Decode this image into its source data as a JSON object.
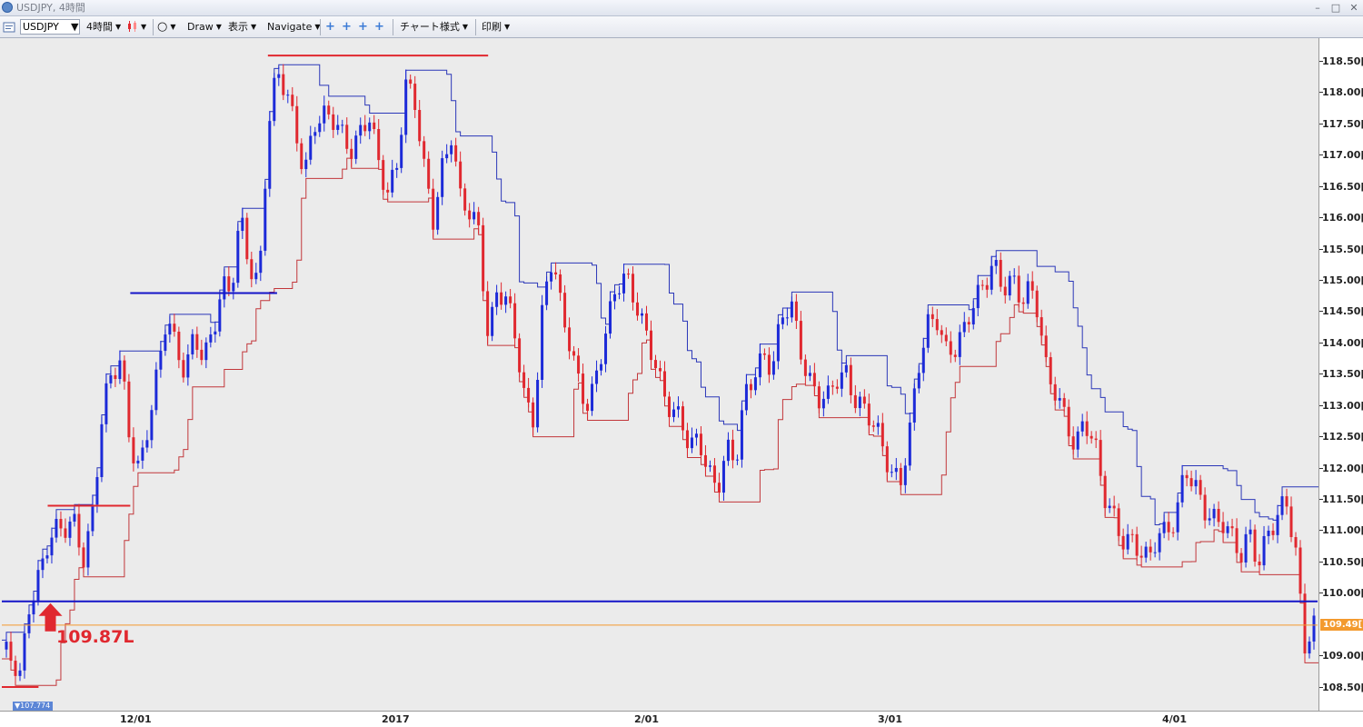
{
  "window": {
    "title": "USDJPY, 4時間",
    "min_glyph": "–",
    "max_glyph": "□",
    "close_glyph": "✕"
  },
  "toolbar": {
    "symbol": "USDJPY",
    "timeframe": "4時間",
    "draw": "Draw",
    "view": "表示",
    "navigate": "Navigate",
    "chart_style": "チャート様式",
    "print": "印刷",
    "dropdown_glyph": "▼",
    "circle_glyph": "○",
    "crosshair_glyph": "+"
  },
  "price_axis": [
    "118.50[0",
    "118.00[0",
    "117.50[0",
    "117.00[0",
    "116.50[0",
    "116.00[0",
    "115.50[0",
    "115.00[0",
    "114.50[0",
    "114.00[0",
    "113.50[0",
    "113.00[0",
    "112.50[0",
    "112.00[0",
    "111.50[0",
    "111.00[0",
    "110.50[0",
    "110.00[0",
    "109.00[0",
    "108.50[0"
  ],
  "time_axis": [
    "12/01",
    "2017",
    "2/01",
    "3/01",
    "4/01"
  ],
  "current_price_label": "109.49[",
  "low_marker_label": "▼107.774",
  "annotation": "109.87L",
  "colors": {
    "up": "#1c2ad8",
    "down": "#e0282f",
    "support": "#1414c8",
    "resistance": "#e0282f",
    "current_price": "#f39a2e",
    "background": "#ebebeb"
  },
  "chart_data": {
    "type": "candlestick",
    "symbol": "USDJPY",
    "timeframe": "4時間",
    "x_ticks": [
      "12/01",
      "2017",
      "2/01",
      "3/01",
      "4/01"
    ],
    "y_ticks": [
      108.5,
      109.0,
      110.0,
      110.5,
      111.0,
      111.5,
      112.0,
      112.5,
      113.0,
      113.5,
      114.0,
      114.5,
      115.0,
      115.5,
      116.0,
      116.5,
      117.0,
      117.5,
      118.0,
      118.5
    ],
    "ylim": [
      108.3,
      118.9
    ],
    "current_price": 109.49,
    "period_low": 107.774,
    "support_level": 109.87,
    "annotation": "109.87L",
    "price_path": [
      [
        0,
        109.1
      ],
      [
        2,
        108.6
      ],
      [
        3,
        109.9
      ],
      [
        5,
        110.8
      ],
      [
        7,
        111.0
      ],
      [
        8,
        111.2
      ],
      [
        9,
        110.6
      ],
      [
        10,
        111.4
      ],
      [
        11,
        112.8
      ],
      [
        12,
        113.5
      ],
      [
        13,
        113.8
      ],
      [
        14,
        112.5
      ],
      [
        15,
        111.9
      ],
      [
        16,
        112.6
      ],
      [
        17,
        113.5
      ],
      [
        18,
        114.6
      ],
      [
        19,
        114.0
      ],
      [
        20,
        113.5
      ],
      [
        21,
        114.0
      ],
      [
        22,
        113.7
      ],
      [
        23,
        114.3
      ],
      [
        24,
        115.0
      ],
      [
        25,
        114.8
      ],
      [
        26,
        115.9
      ],
      [
        27,
        115.2
      ],
      [
        28,
        115.0
      ],
      [
        29,
        117.5
      ],
      [
        30,
        118.3
      ],
      [
        31,
        117.9
      ],
      [
        32,
        117.4
      ],
      [
        33,
        116.8
      ],
      [
        34,
        117.6
      ],
      [
        36,
        117.5
      ],
      [
        38,
        117.2
      ],
      [
        40,
        117.6
      ],
      [
        41,
        116.8
      ],
      [
        42,
        116.4
      ],
      [
        43,
        116.9
      ],
      [
        44,
        118.2
      ],
      [
        45,
        117.8
      ],
      [
        46,
        116.7
      ],
      [
        47,
        116.0
      ],
      [
        48,
        116.9
      ],
      [
        49,
        117.4
      ],
      [
        50,
        116.2
      ],
      [
        52,
        115.8
      ],
      [
        53,
        114.2
      ],
      [
        54,
        114.9
      ],
      [
        55,
        114.6
      ],
      [
        56,
        114.0
      ],
      [
        57,
        113.1
      ],
      [
        58,
        112.9
      ],
      [
        59,
        114.7
      ],
      [
        60,
        115.3
      ],
      [
        61,
        114.4
      ],
      [
        62,
        114.0
      ],
      [
        63,
        113.4
      ],
      [
        64,
        113.0
      ],
      [
        65,
        113.5
      ],
      [
        66,
        114.2
      ],
      [
        67,
        115.0
      ],
      [
        68,
        115.2
      ],
      [
        69,
        114.7
      ],
      [
        70,
        114.1
      ],
      [
        71,
        113.7
      ],
      [
        72,
        113.3
      ],
      [
        74,
        112.8
      ],
      [
        75,
        112.2
      ],
      [
        76,
        112.4
      ],
      [
        77,
        112.0
      ],
      [
        78,
        111.8
      ],
      [
        79,
        112.3
      ],
      [
        80,
        112.0
      ],
      [
        81,
        113.1
      ],
      [
        82,
        113.6
      ],
      [
        83,
        113.9
      ],
      [
        84,
        113.6
      ],
      [
        85,
        114.3
      ],
      [
        86,
        114.6
      ],
      [
        87,
        114.0
      ],
      [
        88,
        113.5
      ],
      [
        89,
        113.1
      ],
      [
        90,
        113.0
      ],
      [
        91,
        113.4
      ],
      [
        92,
        113.6
      ],
      [
        93,
        113.2
      ],
      [
        94,
        112.9
      ],
      [
        95,
        112.6
      ],
      [
        96,
        112.3
      ],
      [
        97,
        112.0
      ],
      [
        98,
        111.9
      ],
      [
        99,
        112.6
      ],
      [
        100,
        113.6
      ],
      [
        101,
        114.3
      ],
      [
        102,
        114.5
      ],
      [
        103,
        113.9
      ],
      [
        104,
        113.9
      ],
      [
        105,
        114.1
      ],
      [
        106,
        114.7
      ],
      [
        107,
        115.0
      ],
      [
        108,
        115.4
      ],
      [
        109,
        114.8
      ],
      [
        110,
        114.9
      ],
      [
        111,
        114.7
      ],
      [
        112,
        115.0
      ],
      [
        113,
        114.6
      ],
      [
        114,
        113.3
      ],
      [
        115,
        113.1
      ],
      [
        116,
        112.7
      ],
      [
        117,
        112.5
      ],
      [
        118,
        112.8
      ],
      [
        119,
        112.4
      ],
      [
        120,
        111.5
      ],
      [
        121,
        111.3
      ],
      [
        122,
        111.0
      ],
      [
        123,
        110.9
      ],
      [
        124,
        110.6
      ],
      [
        125,
        110.4
      ],
      [
        126,
        111.0
      ],
      [
        127,
        111.1
      ],
      [
        128,
        111.3
      ],
      [
        129,
        111.9
      ],
      [
        130,
        111.6
      ],
      [
        131,
        111.4
      ],
      [
        132,
        111.3
      ],
      [
        133,
        111.2
      ],
      [
        134,
        110.8
      ],
      [
        135,
        110.5
      ],
      [
        136,
        111.0
      ],
      [
        137,
        110.6
      ],
      [
        138,
        111.0
      ],
      [
        139,
        111.1
      ],
      [
        140,
        111.4
      ],
      [
        141,
        110.7
      ],
      [
        142,
        109.3
      ],
      [
        143,
        109.49
      ]
    ],
    "lines": [
      {
        "kind": "horizontal",
        "color": "blue",
        "price": 109.87,
        "from": 0,
        "to": 143
      },
      {
        "kind": "horizontal",
        "color": "red",
        "price": 118.6,
        "from": 29,
        "to": 53
      },
      {
        "kind": "horizontal",
        "color": "blue",
        "price": 114.8,
        "from": 14,
        "to": 30
      },
      {
        "kind": "horizontal",
        "color": "red",
        "price": 111.4,
        "from": 5,
        "to": 14
      },
      {
        "kind": "horizontal",
        "color": "red",
        "price": 108.5,
        "from": 0,
        "to": 4
      },
      {
        "kind": "horizontal",
        "color": "orange",
        "price": 109.49,
        "from": 0,
        "to": 143
      }
    ]
  }
}
